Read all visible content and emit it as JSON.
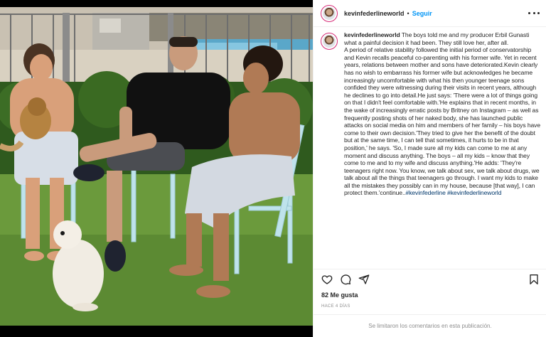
{
  "post": {
    "username": "kevinfederlineworld",
    "separator": "•",
    "follow_label": "Seguir",
    "caption_part1": "The boys told me and my producer Erbil Gunasti what a painful decision it had been. They still love her, after all.",
    "caption_part2": "A period of relative stability followed the initial period of conservatorship and Kevin recalls peaceful co-parenting with his former wife. Yet in recent years, relations between mother and sons have deteriorated.Kevin clearly has no wish to embarrass his former wife but acknowledges he became increasingly uncomfortable with what his then younger teenage sons confided they were witnessing during their visits in recent years, although he declines to go into detail.He just says: 'There were a lot of things going on that I didn't feel comfortable with.'He explains that in recent months, in the wake of increasingly erratic posts by Britney on Instagram – as well as frequently posting shots of her naked body, she has launched public attacks on social media on him and members of her family – his boys have come to their own decision.'They tried to give her the benefit of the doubt but at the same time, I can tell that sometimes, it hurts to be in that position,' he says. 'So, I made sure all my kids can come to me at any moment and discuss anything. The boys – all my kids – know that they come to me and to my wife and discuss anything.'He adds: 'They're teenagers right now. You know, we talk about sex, we talk about drugs, we talk about all the things that teenagers go through. I want my kids to make all the mistakes they possibly can in my house, because [that way], I can protect them.'continue..",
    "hashtag1": "#kevinfederline",
    "hashtag2": "#kevinfederlineworld",
    "likes": "82 Me gusta",
    "date": "HACE 4 DÍAS",
    "comments_disabled": "Se limitaron los comentarios en esta publicación."
  },
  "icons": {
    "like": "heart-icon",
    "comment": "comment-icon",
    "share": "share-icon",
    "save": "bookmark-icon",
    "more": "more-options-icon"
  },
  "colors": {
    "link": "#0095f6",
    "hashtag": "#00376b",
    "muted": "#8e8e8e",
    "text": "#262626"
  }
}
